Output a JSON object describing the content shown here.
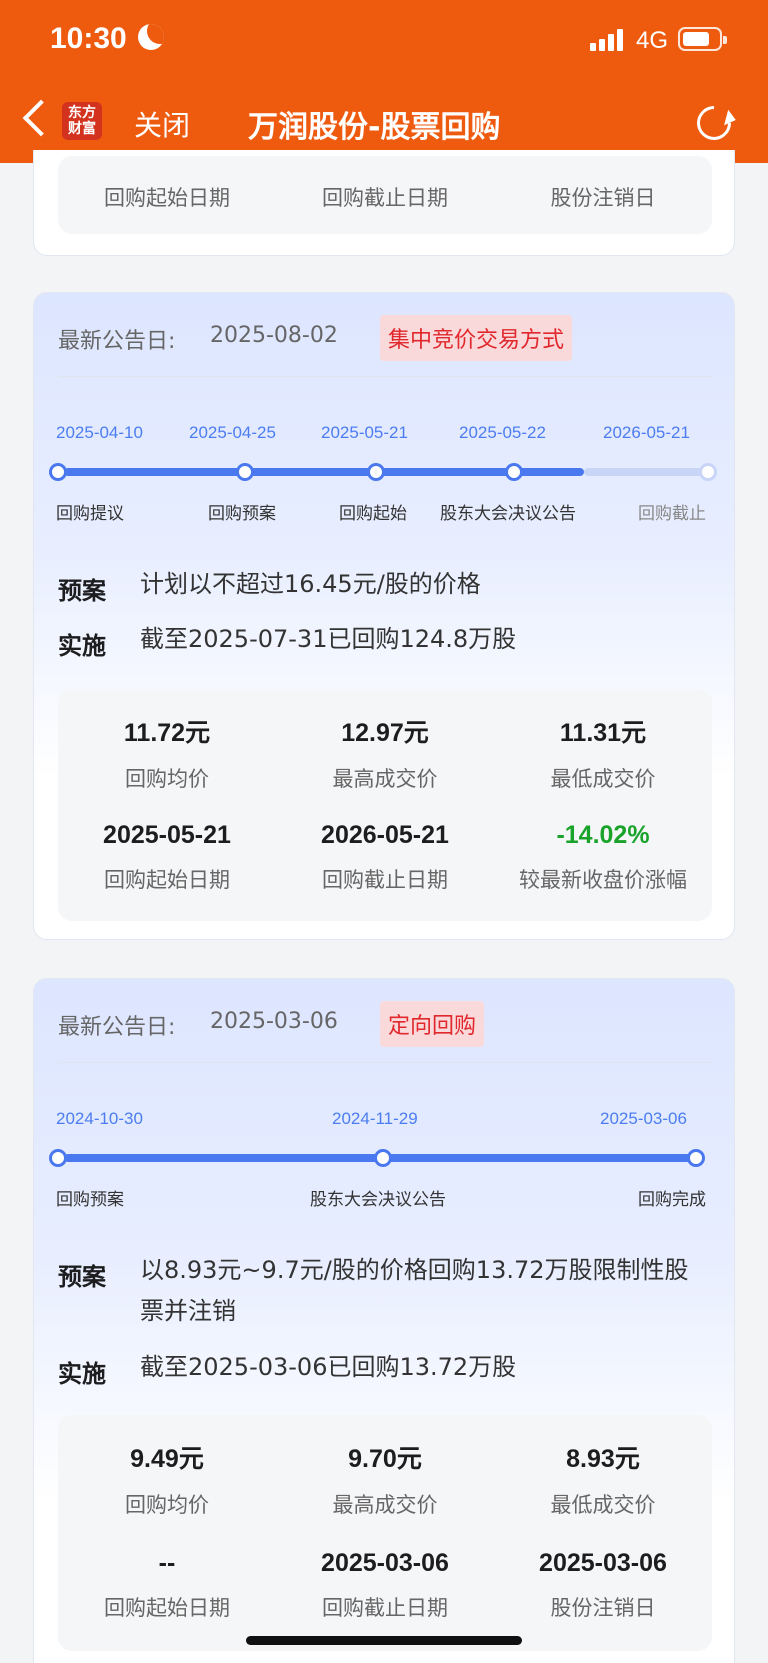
{
  "status": {
    "time": "10:30",
    "network": "4G"
  },
  "header": {
    "close_label": "关闭",
    "title": "万润股份-股票回购",
    "logo_text": "东方财富"
  },
  "top_remnant": {
    "labels": [
      "回购起始日期",
      "回购截止日期",
      "股份注销日"
    ]
  },
  "cards": [
    {
      "announce_label": "最新公告日:",
      "announce_date": "2025-08-02",
      "tag": "集中竞价交易方式",
      "timeline": {
        "dates": [
          "2025-04-10",
          "2025-04-25",
          "2025-05-21",
          "2025-05-22",
          "2026-05-21"
        ],
        "labels": [
          "回购提议",
          "回购预案",
          "回购起始",
          "股东大会决议公告",
          "回购截止"
        ],
        "completed_steps": 4
      },
      "plan_key": "预案",
      "plan_text": "计划以不超过16.45元/股的价格",
      "impl_key": "实施",
      "impl_text": "截至2025-07-31已回购124.8万股",
      "stats": [
        {
          "value": "11.72元",
          "label": "回购均价"
        },
        {
          "value": "12.97元",
          "label": "最高成交价"
        },
        {
          "value": "11.31元",
          "label": "最低成交价"
        },
        {
          "value": "2025-05-21",
          "label": "回购起始日期"
        },
        {
          "value": "2026-05-21",
          "label": "回购截止日期"
        },
        {
          "value": "-14.02%",
          "label": "较最新收盘价涨幅"
        }
      ]
    },
    {
      "announce_label": "最新公告日:",
      "announce_date": "2025-03-06",
      "tag": "定向回购",
      "timeline": {
        "dates": [
          "2024-10-30",
          "2024-11-29",
          "2025-03-06"
        ],
        "labels": [
          "回购预案",
          "股东大会决议公告",
          "回购完成"
        ],
        "completed_steps": 3
      },
      "plan_key": "预案",
      "plan_text": "以8.93元~9.7元/股的价格回购13.72万股限制性股票并注销",
      "impl_key": "实施",
      "impl_text": "截至2025-03-06已回购13.72万股",
      "stats": [
        {
          "value": "9.49元",
          "label": "回购均价"
        },
        {
          "value": "9.70元",
          "label": "最高成交价"
        },
        {
          "value": "8.93元",
          "label": "最低成交价"
        },
        {
          "value": "--",
          "label": "回购起始日期"
        },
        {
          "value": "2025-03-06",
          "label": "回购截止日期"
        },
        {
          "value": "2025-03-06",
          "label": "股份注销日"
        }
      ]
    }
  ],
  "colors": {
    "header": "#ee5a0e",
    "accent": "#4a78ef",
    "tag_text": "#e0282d",
    "negative_change": "#1aa32b"
  }
}
